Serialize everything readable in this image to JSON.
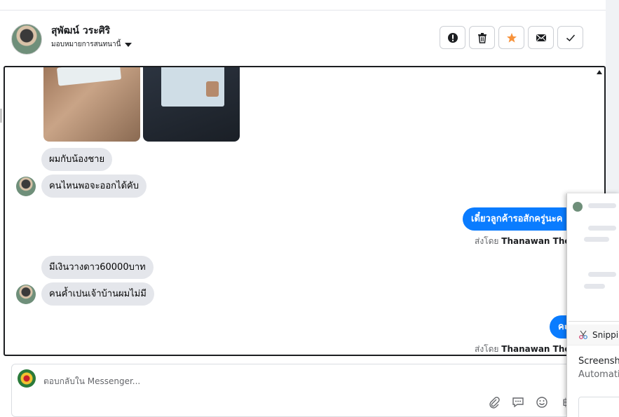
{
  "header": {
    "name": "สุพัฒน์ วระศิริ",
    "subtitle": "มอบหมายการสนทนานี้",
    "actions": [
      {
        "icon": "alert-circle-icon",
        "label": "Spam"
      },
      {
        "icon": "trash-icon",
        "label": "Delete"
      },
      {
        "icon": "star-icon",
        "label": "Follow up",
        "color": "#f7923a"
      },
      {
        "icon": "envelope-icon",
        "label": "Mark unread"
      },
      {
        "icon": "check-icon",
        "label": "Done"
      }
    ]
  },
  "messages": {
    "in1": "ผมกับน้องชาย",
    "in2": "คนไหนพอจะออกได้คับ",
    "out1": "เดี๋ยวลูกค้ารอสักครู่นะค",
    "sent_by_prefix": "ส่งโดย",
    "sent_by_name": "Thanawan Thon",
    "in3": "มีเงินวางดาว60000บาท",
    "in4": "คนค้ำเปนเจ้าบ้านผมไม่มี",
    "out2": "คะ"
  },
  "composer": {
    "placeholder": "ตอบกลับใน Messenger..."
  },
  "snip": {
    "title": "Snippi",
    "line1": "Screensho",
    "line2": "Automatio"
  },
  "colors": {
    "outgoing_bubble": "#0a7cff",
    "incoming_bubble": "#e4e6eb",
    "star": "#f7923a"
  }
}
